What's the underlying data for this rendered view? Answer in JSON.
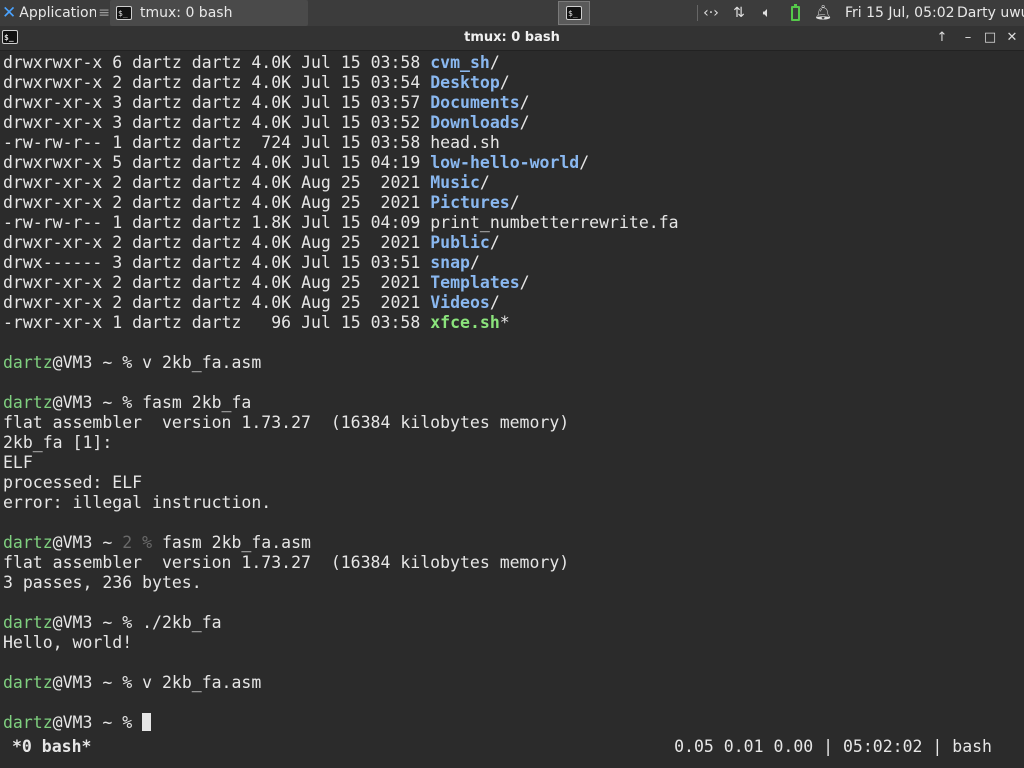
{
  "panel": {
    "apps_label": "Applications",
    "apps_sep": "≡",
    "task_label": "tmux: 0 bash",
    "clock": "Fri 15 Jul, 05:02",
    "user": "Darty uwu",
    "tray_icons": [
      "network-icon",
      "transfer-icon",
      "volume-icon",
      "battery-icon",
      "bell-icon"
    ]
  },
  "window": {
    "title": "tmux: 0 bash",
    "buttons": {
      "up": "↑",
      "minimize": "–",
      "maximize": "□",
      "close": "✕"
    }
  },
  "terminal": {
    "listing": [
      {
        "perm": "drwxrwxr-x",
        "links": "6",
        "owner": "dartz",
        "group": "dartz",
        "size": "4.0K",
        "mon": "Jul",
        "day": "15",
        "time": "03:58",
        "name": "cvm_sh",
        "suffix": "/",
        "kind": "dir"
      },
      {
        "perm": "drwxrwxr-x",
        "links": "2",
        "owner": "dartz",
        "group": "dartz",
        "size": "4.0K",
        "mon": "Jul",
        "day": "15",
        "time": "03:54",
        "name": "Desktop",
        "suffix": "/",
        "kind": "dir"
      },
      {
        "perm": "drwxr-xr-x",
        "links": "3",
        "owner": "dartz",
        "group": "dartz",
        "size": "4.0K",
        "mon": "Jul",
        "day": "15",
        "time": "03:57",
        "name": "Documents",
        "suffix": "/",
        "kind": "dir"
      },
      {
        "perm": "drwxr-xr-x",
        "links": "3",
        "owner": "dartz",
        "group": "dartz",
        "size": "4.0K",
        "mon": "Jul",
        "day": "15",
        "time": "03:52",
        "name": "Downloads",
        "suffix": "/",
        "kind": "dir"
      },
      {
        "perm": "-rw-rw-r--",
        "links": "1",
        "owner": "dartz",
        "group": "dartz",
        "size": " 724",
        "mon": "Jul",
        "day": "15",
        "time": "03:58",
        "name": "head.sh",
        "suffix": "",
        "kind": "file"
      },
      {
        "perm": "drwxrwxr-x",
        "links": "5",
        "owner": "dartz",
        "group": "dartz",
        "size": "4.0K",
        "mon": "Jul",
        "day": "15",
        "time": "04:19",
        "name": "low-hello-world",
        "suffix": "/",
        "kind": "dir"
      },
      {
        "perm": "drwxr-xr-x",
        "links": "2",
        "owner": "dartz",
        "group": "dartz",
        "size": "4.0K",
        "mon": "Aug",
        "day": "25",
        "time": " 2021",
        "name": "Music",
        "suffix": "/",
        "kind": "dir"
      },
      {
        "perm": "drwxr-xr-x",
        "links": "2",
        "owner": "dartz",
        "group": "dartz",
        "size": "4.0K",
        "mon": "Aug",
        "day": "25",
        "time": " 2021",
        "name": "Pictures",
        "suffix": "/",
        "kind": "dir"
      },
      {
        "perm": "-rw-rw-r--",
        "links": "1",
        "owner": "dartz",
        "group": "dartz",
        "size": "1.8K",
        "mon": "Jul",
        "day": "15",
        "time": "04:09",
        "name": "print_numbetterrewrite.fa",
        "suffix": "",
        "kind": "file"
      },
      {
        "perm": "drwxr-xr-x",
        "links": "2",
        "owner": "dartz",
        "group": "dartz",
        "size": "4.0K",
        "mon": "Aug",
        "day": "25",
        "time": " 2021",
        "name": "Public",
        "suffix": "/",
        "kind": "dir"
      },
      {
        "perm": "drwx------",
        "links": "3",
        "owner": "dartz",
        "group": "dartz",
        "size": "4.0K",
        "mon": "Jul",
        "day": "15",
        "time": "03:51",
        "name": "snap",
        "suffix": "/",
        "kind": "dir"
      },
      {
        "perm": "drwxr-xr-x",
        "links": "2",
        "owner": "dartz",
        "group": "dartz",
        "size": "4.0K",
        "mon": "Aug",
        "day": "25",
        "time": " 2021",
        "name": "Templates",
        "suffix": "/",
        "kind": "dir"
      },
      {
        "perm": "drwxr-xr-x",
        "links": "2",
        "owner": "dartz",
        "group": "dartz",
        "size": "4.0K",
        "mon": "Aug",
        "day": "25",
        "time": " 2021",
        "name": "Videos",
        "suffix": "/",
        "kind": "dir"
      },
      {
        "perm": "-rwxr-xr-x",
        "links": "1",
        "owner": "dartz",
        "group": "dartz",
        "size": "  96",
        "mon": "Jul",
        "day": "15",
        "time": "03:58",
        "name": "xfce.sh",
        "suffix": "*",
        "kind": "exe"
      }
    ],
    "session": [
      {
        "type": "blank"
      },
      {
        "type": "prompt",
        "user": "dartz",
        "host": "@VM3 ~ ",
        "status": "%",
        "status_dim": false,
        "cmd": " v 2kb_fa.asm"
      },
      {
        "type": "blank"
      },
      {
        "type": "prompt",
        "user": "dartz",
        "host": "@VM3 ~ ",
        "status": "%",
        "status_dim": false,
        "cmd": " fasm 2kb_fa"
      },
      {
        "type": "out",
        "text": "flat assembler  version 1.73.27  (16384 kilobytes memory)"
      },
      {
        "type": "out",
        "text": "2kb_fa [1]:"
      },
      {
        "type": "out",
        "text": "ELF"
      },
      {
        "type": "out",
        "text": "processed: ELF"
      },
      {
        "type": "out",
        "text": "error: illegal instruction."
      },
      {
        "type": "blank"
      },
      {
        "type": "prompt",
        "user": "dartz",
        "host": "@VM3 ~ ",
        "status": "2 %",
        "status_dim": true,
        "cmd": " fasm 2kb_fa.asm"
      },
      {
        "type": "out",
        "text": "flat assembler  version 1.73.27  (16384 kilobytes memory)"
      },
      {
        "type": "out",
        "text": "3 passes, 236 bytes."
      },
      {
        "type": "blank"
      },
      {
        "type": "prompt",
        "user": "dartz",
        "host": "@VM3 ~ ",
        "status": "%",
        "status_dim": false,
        "cmd": " ./2kb_fa"
      },
      {
        "type": "out",
        "text": "Hello, world!"
      },
      {
        "type": "blank"
      },
      {
        "type": "prompt",
        "user": "dartz",
        "host": "@VM3 ~ ",
        "status": "%",
        "status_dim": false,
        "cmd": " v 2kb_fa.asm"
      },
      {
        "type": "blank"
      },
      {
        "type": "prompt",
        "user": "dartz",
        "host": "@VM3 ~ ",
        "status": "%",
        "status_dim": false,
        "cmd": " ",
        "cursor": true
      }
    ]
  },
  "status": {
    "window": "*0 bash*",
    "right": "0.05 0.01 0.00 | 05:02:02 | bash"
  },
  "colors": {
    "dir": "#8ab8f0",
    "exe": "#8be47c",
    "prompt_user": "#7fd07f",
    "background": "#2b2b2b"
  }
}
